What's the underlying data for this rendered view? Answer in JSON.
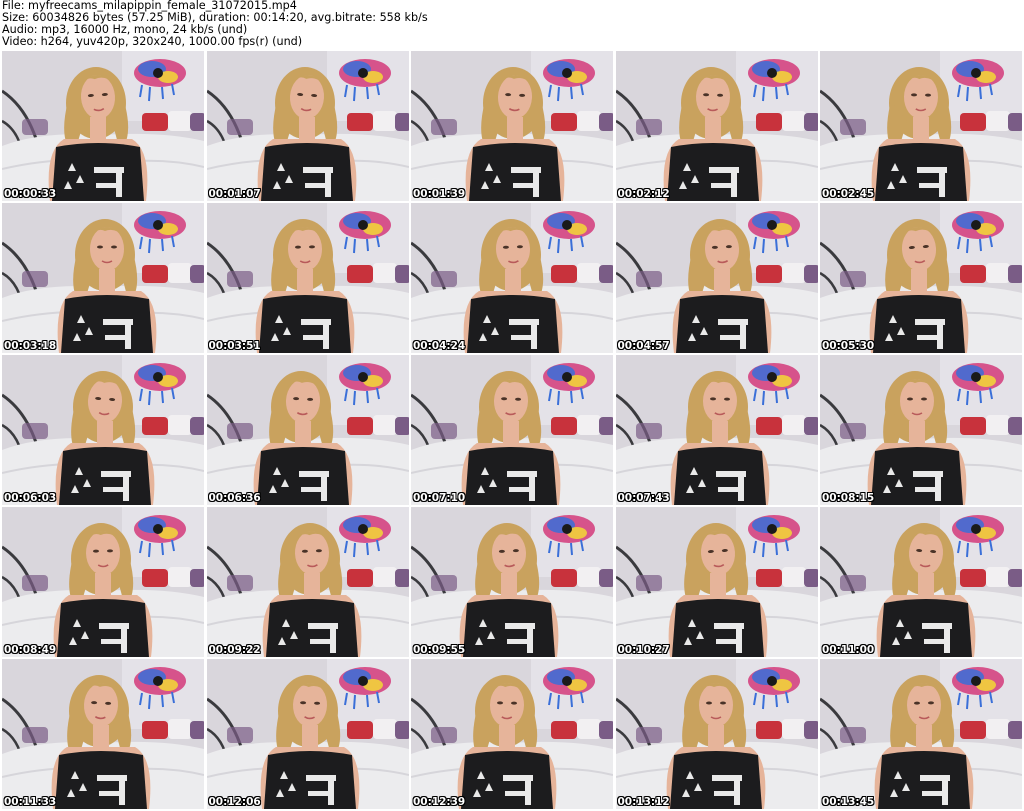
{
  "header": {
    "file_line": "File: myfreecams_milapippin_female_31072015.mp4",
    "size_line": "Size: 60034826 bytes (57.25 MiB), duration: 00:14:20, avg.bitrate: 558 kb/s",
    "audio_line": "Audio: mp3, 16000 Hz, mono, 24 kb/s (und)",
    "video_line": "Video: h264, yuv420p, 320x240, 1000.00 fps(r) (und)"
  },
  "thumbnails": [
    {
      "timestamp": "00:00:33"
    },
    {
      "timestamp": "00:01:07"
    },
    {
      "timestamp": "00:01:39"
    },
    {
      "timestamp": "00:02:12"
    },
    {
      "timestamp": "00:02:45"
    },
    {
      "timestamp": "00:03:18"
    },
    {
      "timestamp": "00:03:51"
    },
    {
      "timestamp": "00:04:24"
    },
    {
      "timestamp": "00:04:57"
    },
    {
      "timestamp": "00:05:30"
    },
    {
      "timestamp": "00:06:03"
    },
    {
      "timestamp": "00:06:36"
    },
    {
      "timestamp": "00:07:10"
    },
    {
      "timestamp": "00:07:43"
    },
    {
      "timestamp": "00:08:15"
    },
    {
      "timestamp": "00:08:49"
    },
    {
      "timestamp": "00:09:22"
    },
    {
      "timestamp": "00:09:55"
    },
    {
      "timestamp": "00:10:27"
    },
    {
      "timestamp": "00:11:00"
    },
    {
      "timestamp": "00:11:33"
    },
    {
      "timestamp": "00:12:06"
    },
    {
      "timestamp": "00:12:39"
    },
    {
      "timestamp": "00:13:12"
    },
    {
      "timestamp": "00:13:45"
    }
  ],
  "colors": {
    "background": "#ffffff",
    "timestamp_text": "#ffffff",
    "timestamp_outline": "#000000",
    "wall": "#d9d6dc",
    "sofa": "#ececee",
    "shirt": "#1c1c1e",
    "hair": "#c9a25e",
    "skin": "#e6b49a",
    "pillow_red": "#c8323c",
    "pillow_purple": "#7a5c86"
  }
}
